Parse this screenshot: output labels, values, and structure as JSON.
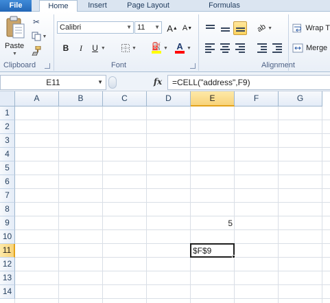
{
  "tabs": {
    "file": "File",
    "home": "Home",
    "insert": "Insert",
    "page_layout": "Page Layout",
    "formulas": "Formulas"
  },
  "clipboard": {
    "paste_label": "Paste",
    "group_label": "Clipboard"
  },
  "font": {
    "name": "Calibri",
    "size": "11",
    "grow_label": "A",
    "shrink_label": "A",
    "bold_label": "B",
    "italic_label": "I",
    "underline_label": "U",
    "color_label": "A",
    "group_label": "Font",
    "highlight_color": "#ffff00",
    "font_color": "#ff0000"
  },
  "alignment": {
    "wrap_label": "Wrap T",
    "merge_label": "Merge",
    "group_label": "Alignment"
  },
  "formula_bar": {
    "name_box": "E11",
    "fx_label": "fx",
    "formula": "=CELL(\"address\",F9)"
  },
  "sheet": {
    "columns": [
      "A",
      "B",
      "C",
      "D",
      "E",
      "F",
      "G"
    ],
    "rows": [
      "1",
      "2",
      "3",
      "4",
      "5",
      "6",
      "7",
      "8",
      "9",
      "10",
      "11",
      "12",
      "13",
      "14"
    ],
    "selected_column": "E",
    "selected_row": "11",
    "cells": {
      "E9": "5",
      "E11": "$F$9"
    }
  }
}
